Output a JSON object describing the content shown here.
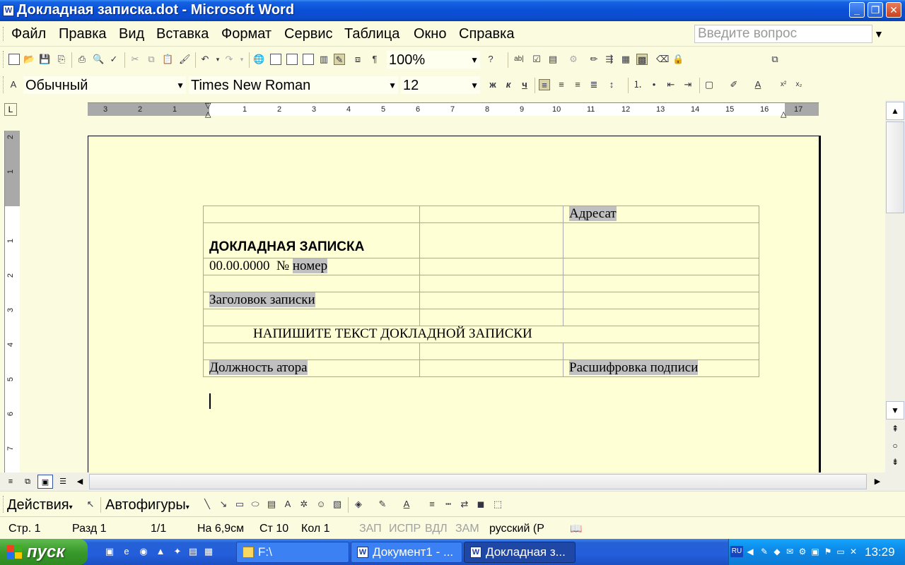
{
  "window": {
    "title": "Докладная записка.dot - Microsoft Word",
    "minimize": "_",
    "maximize": "❐",
    "close": "✕"
  },
  "menu": {
    "items": [
      "Файл",
      "Правка",
      "Вид",
      "Вставка",
      "Формат",
      "Сервис",
      "Таблица",
      "Окно",
      "Справка"
    ],
    "help_placeholder": "Введите вопрос"
  },
  "toolbar_standard": {
    "zoom": "100%"
  },
  "toolbar_format": {
    "style": "Обычный",
    "font": "Times New Roman",
    "size": "12",
    "bold": "ж",
    "italic": "к",
    "underline": "ч"
  },
  "ruler": {
    "h_ticks": [
      "3",
      "2",
      "1",
      "1",
      "2",
      "3",
      "4",
      "5",
      "6",
      "7",
      "8",
      "9",
      "10",
      "11",
      "12",
      "13",
      "14",
      "15",
      "16",
      "17"
    ],
    "v_ticks": [
      "2",
      "1",
      "1",
      "2",
      "3",
      "4",
      "5",
      "6",
      "7"
    ],
    "corner": "L"
  },
  "document": {
    "addressee": "Адресат",
    "memo_title": "ДОКЛАДНАЯ ЗАПИСКА",
    "date": "00.00.0000",
    "number_sign": "№",
    "number": "номер",
    "heading": "Заголовок записки",
    "body": "НАПИШИТЕ ТЕКСТ ДОКЛАДНОЙ ЗАПИСКИ",
    "author_position": "Должность атора",
    "signature": "Расшифровка подписи"
  },
  "drawing_toolbar": {
    "actions": "Действия",
    "autoshapes": "Автофигуры"
  },
  "status": {
    "page": "Стр. 1",
    "section": "Разд 1",
    "pages": "1/1",
    "at": "На 6,9см",
    "line": "Ст 10",
    "column": "Кол 1",
    "rec": "ЗАП",
    "trk": "ИСПР",
    "ext": "ВДЛ",
    "ovr": "ЗАМ",
    "language": "русский (Р"
  },
  "taskbar": {
    "start": "пуск",
    "tasks": [
      "F:\\",
      "Документ1 - ...",
      "Докладная з..."
    ],
    "lang": "RU",
    "clock": "13:29"
  }
}
